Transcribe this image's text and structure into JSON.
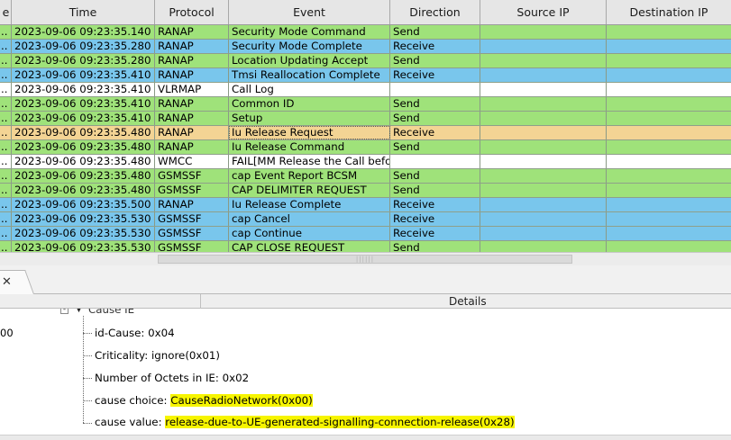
{
  "table": {
    "columns": [
      "e",
      "Time",
      "Protocol",
      "Event",
      "Direction",
      "Source IP",
      "Destination IP"
    ],
    "rows": [
      {
        "lead": "..",
        "time": "2023-09-06 09:23:35.140",
        "protocol": "RANAP",
        "event": "Security Mode Command",
        "direction": "Send",
        "color": "green"
      },
      {
        "lead": "..",
        "time": "2023-09-06 09:23:35.280",
        "protocol": "RANAP",
        "event": "Security Mode Complete",
        "direction": "Receive",
        "color": "blue"
      },
      {
        "lead": "..",
        "time": "2023-09-06 09:23:35.280",
        "protocol": "RANAP",
        "event": "Location Updating Accept",
        "direction": "Send",
        "color": "green"
      },
      {
        "lead": "..",
        "time": "2023-09-06 09:23:35.410",
        "protocol": "RANAP",
        "event": "Tmsi Reallocation Complete",
        "direction": "Receive",
        "color": "blue"
      },
      {
        "lead": "..",
        "time": "2023-09-06 09:23:35.410",
        "protocol": "VLRMAP",
        "event": "Call Log",
        "direction": "",
        "color": "white"
      },
      {
        "lead": "..",
        "time": "2023-09-06 09:23:35.410",
        "protocol": "RANAP",
        "event": "Common ID",
        "direction": "Send",
        "color": "green"
      },
      {
        "lead": "..",
        "time": "2023-09-06 09:23:35.410",
        "protocol": "RANAP",
        "event": "Setup",
        "direction": "Send",
        "color": "green"
      },
      {
        "lead": "..",
        "time": "2023-09-06 09:23:35.480",
        "protocol": "RANAP",
        "event": "Iu Release Request",
        "direction": "Receive",
        "color": "tan",
        "selected": true
      },
      {
        "lead": "..",
        "time": "2023-09-06 09:23:35.480",
        "protocol": "RANAP",
        "event": "Iu Release Command",
        "direction": "Send",
        "color": "green"
      },
      {
        "lead": "..",
        "time": "2023-09-06 09:23:35.480",
        "protocol": "WMCC",
        "event": "FAIL[MM Release the Call befo...",
        "direction": "",
        "color": "white"
      },
      {
        "lead": "..",
        "time": "2023-09-06 09:23:35.480",
        "protocol": "GSMSSF",
        "event": "cap Event Report BCSM",
        "direction": "Send",
        "color": "green"
      },
      {
        "lead": "..",
        "time": "2023-09-06 09:23:35.480",
        "protocol": "GSMSSF",
        "event": "CAP DELIMITER REQUEST",
        "direction": "Send",
        "color": "green"
      },
      {
        "lead": "..",
        "time": "2023-09-06 09:23:35.500",
        "protocol": "RANAP",
        "event": "Iu Release Complete",
        "direction": "Receive",
        "color": "blue"
      },
      {
        "lead": "..",
        "time": "2023-09-06 09:23:35.530",
        "protocol": "GSMSSF",
        "event": "cap Cancel",
        "direction": "Receive",
        "color": "blue"
      },
      {
        "lead": "..",
        "time": "2023-09-06 09:23:35.530",
        "protocol": "GSMSSF",
        "event": "cap Continue",
        "direction": "Receive",
        "color": "blue"
      },
      {
        "lead": "..",
        "time": "2023-09-06 09:23:35.530",
        "protocol": "GSMSSF",
        "event": "CAP CLOSE REQUEST",
        "direction": "Send",
        "color": "green"
      }
    ]
  },
  "colors": {
    "green": "#9fe27a",
    "blue": "#79c6ec",
    "white": "#ffffff",
    "tan": "#f3d494",
    "highlight": "#f7f500"
  },
  "tab": {
    "close_icon": "close-icon"
  },
  "details": {
    "title": "Details",
    "left_value": "00",
    "tree": {
      "expander": "-",
      "node_label": "Cause IE",
      "children": [
        {
          "label": "id-Cause: 0x04"
        },
        {
          "label": "Criticality: ignore(0x01)"
        },
        {
          "label": "Number of Octets in IE: 0x02"
        },
        {
          "prefix": "cause choice: ",
          "value": "CauseRadioNetwork(0x00)"
        },
        {
          "prefix": "cause value: ",
          "value": "release-due-to-UE-generated-signalling-connection-release(0x28)"
        }
      ]
    }
  }
}
